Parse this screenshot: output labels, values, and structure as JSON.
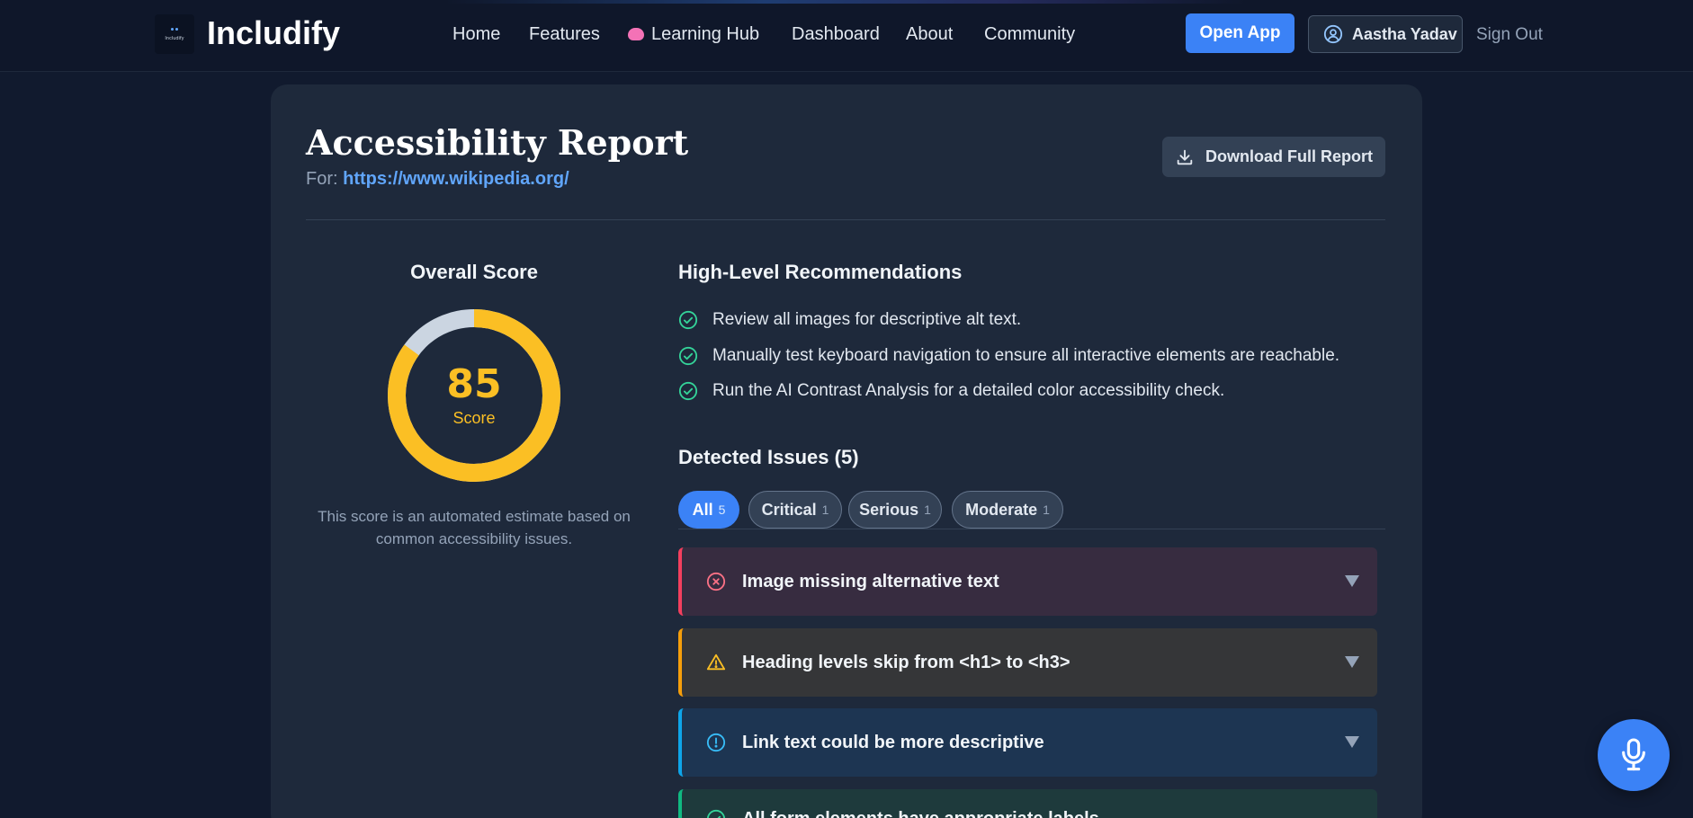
{
  "header": {
    "logo_small_text": "Includify",
    "brand": "Includify",
    "nav": [
      "Home",
      "Features",
      "Learning Hub",
      "Dashboard",
      "About",
      "Community"
    ],
    "learning_hub_icon": "brain-icon",
    "open_app": "Open App",
    "user_name": "Aastha Yadav",
    "sign_out": "Sign Out"
  },
  "report": {
    "title": "Accessibility Report",
    "for_label": "For:",
    "url": "https://www.wikipedia.org/",
    "download": "Download Full Report"
  },
  "score": {
    "title": "Overall Score",
    "value": "85",
    "fraction": 0.85,
    "label": "Score",
    "note": "This score is an automated estimate based on common accessibility issues."
  },
  "recommendations": {
    "title": "High-Level Recommendations",
    "items": [
      "Review all images for descriptive alt text.",
      "Manually test keyboard navigation to ensure all interactive elements are reachable.",
      "Run the AI Contrast Analysis for a detailed color accessibility check."
    ]
  },
  "issues": {
    "title": "Detected Issues (5)",
    "filters": [
      {
        "label": "All",
        "count": "5"
      },
      {
        "label": "Critical",
        "count": "1"
      },
      {
        "label": "Serious",
        "count": "1"
      },
      {
        "label": "Moderate",
        "count": "1"
      }
    ],
    "list": [
      {
        "title": "Image missing alternative text",
        "severity": "critical",
        "icon": "x-circle-icon"
      },
      {
        "title": "Heading levels skip from <h1> to <h3>",
        "severity": "serious",
        "icon": "warning-icon"
      },
      {
        "title": "Link text could be more descriptive",
        "severity": "moderate",
        "icon": "info-circle-icon"
      },
      {
        "title": "All form elements have appropriate labels",
        "severity": "pass",
        "icon": "check-circle-icon"
      }
    ]
  },
  "colors": {
    "accent": "#3b82f6",
    "score": "#fbbf24",
    "critical": "#f43f5e",
    "serious": "#f59e0b",
    "moderate": "#0ea5e9",
    "pass": "#10b981"
  }
}
